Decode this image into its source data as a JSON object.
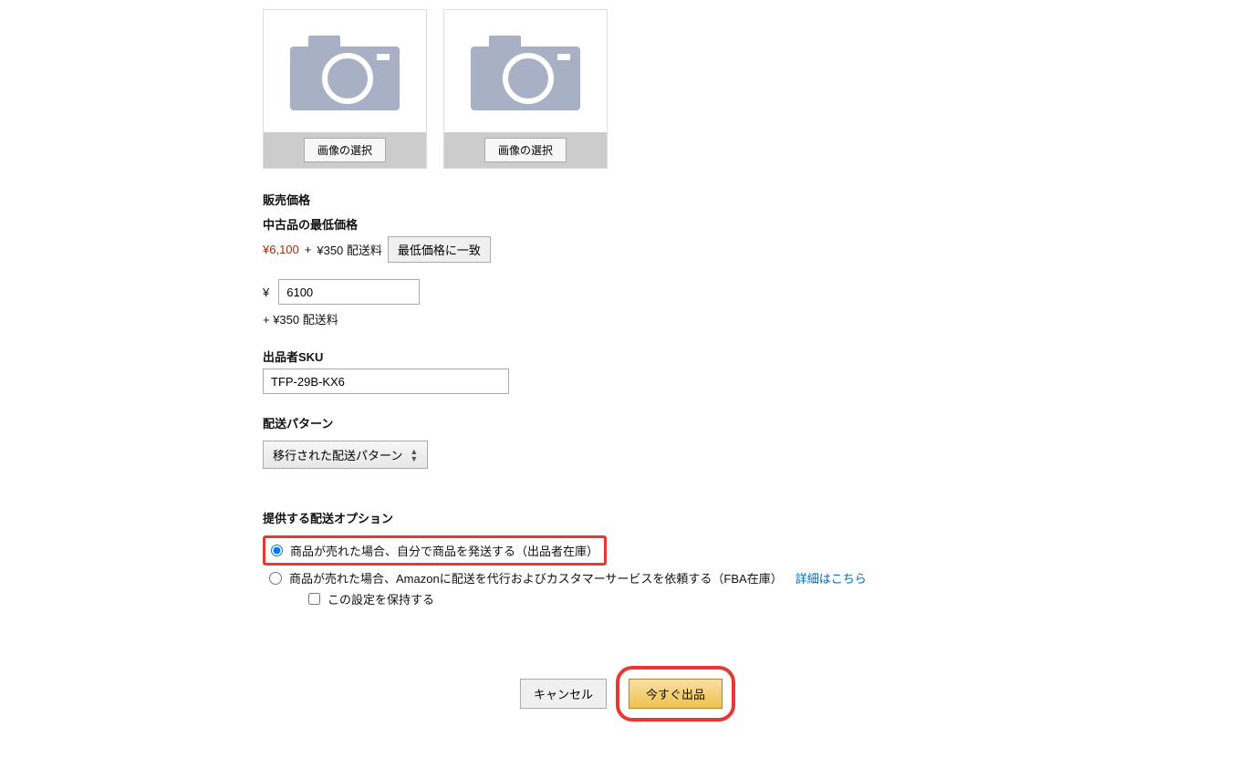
{
  "images": {
    "select_label": "画像の選択"
  },
  "price": {
    "heading": "販売価格",
    "used_lowest_label": "中古品の最低価格",
    "lowest_price": "¥6,100",
    "plus": "+",
    "shipping": "¥350 配送料",
    "match_button": "最低価格に一致",
    "currency": "¥",
    "value": "6100",
    "shipping_below": "+ ¥350 配送料"
  },
  "sku": {
    "label": "出品者SKU",
    "value": "TFP-29B-KX6"
  },
  "shipping_pattern": {
    "label": "配送パターン",
    "selected": "移行された配送パターン"
  },
  "shipping_option": {
    "heading": "提供する配送オプション",
    "self_ship": "商品が売れた場合、自分で商品を発送する（出品者在庫）",
    "fba_ship": "商品が売れた場合、Amazonに配送を代行およびカスタマーサービスを依頼する（FBA在庫）",
    "details_link": "詳細はこちら",
    "save_setting": "この設定を保持する"
  },
  "buttons": {
    "cancel": "キャンセル",
    "submit": "今すぐ出品"
  }
}
